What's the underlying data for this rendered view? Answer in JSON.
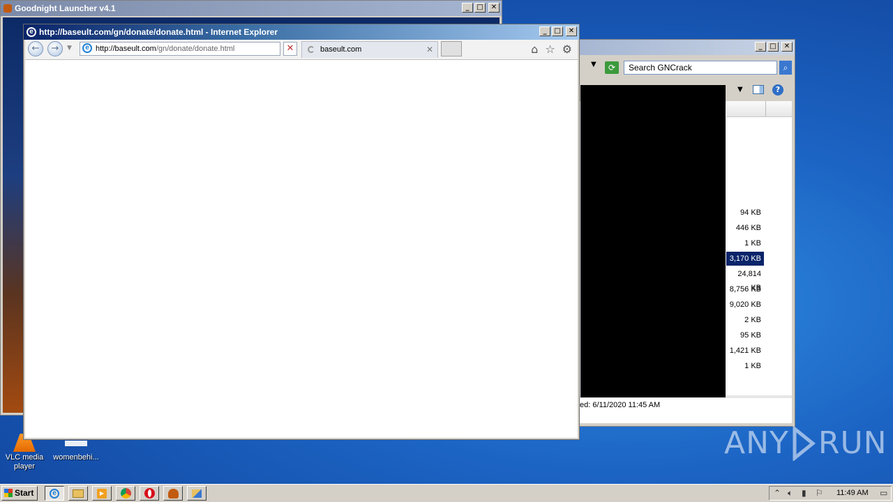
{
  "goodnight_window": {
    "title": "Goodnight Launcher v4.1"
  },
  "explorer_window": {
    "search_placeholder": "Search GNCrack",
    "file_sizes": [
      "94 KB",
      "446 KB",
      "1 KB",
      "3,170 KB",
      "24,814 KB",
      "8,756 KB",
      "9,020 KB",
      "2 KB",
      "95 KB",
      "1,421 KB",
      "1 KB"
    ],
    "selected_index": 3,
    "status_text": "ed: 6/11/2020 11:45 AM"
  },
  "ie_window": {
    "title": "http://baseult.com/gn/donate/donate.html - Internet Explorer",
    "address_host": "http://baseult.com",
    "address_path": "/gn/donate/donate.html",
    "tab_label": "baseult.com"
  },
  "desktop_icons": [
    {
      "label": "VLC media player"
    },
    {
      "label": "womenbehi..."
    }
  ],
  "watermark": {
    "left": "ANY",
    "right": "RUN"
  },
  "taskbar": {
    "start_label": "Start",
    "clock": "11:49 AM"
  },
  "icons": {
    "ie": "internet-explorer-icon",
    "folder": "folder-icon",
    "media": "media-player-icon",
    "chrome": "chrome-icon",
    "opera": "opera-icon",
    "goodnight": "goodnight-app-icon",
    "network": "network-icon"
  }
}
